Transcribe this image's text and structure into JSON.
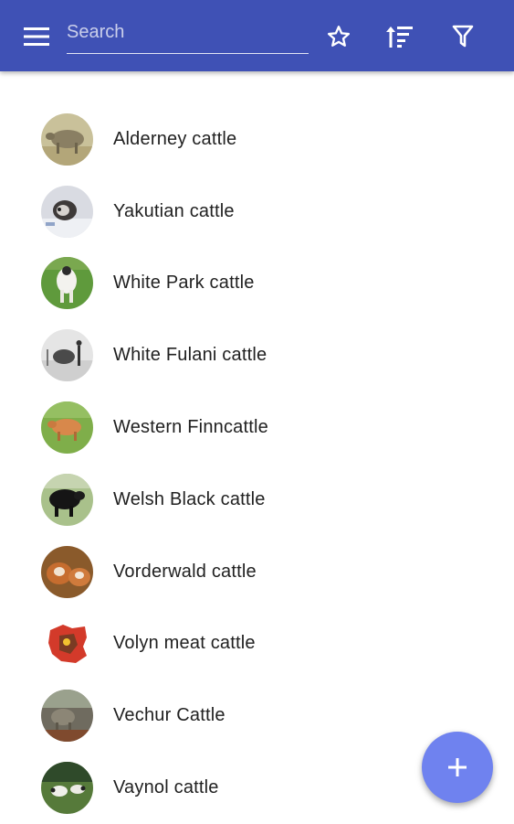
{
  "colors": {
    "appbar": "#3f51b5",
    "fab": "#6f82ef",
    "text": "#212121"
  },
  "appbar": {
    "menu_icon": "hamburger-menu-icon",
    "search": {
      "placeholder": "Search",
      "value": ""
    },
    "favorite_icon": "star-outline-icon",
    "sort_icon": "sort-icon",
    "filter_icon": "filter-icon"
  },
  "list": {
    "items": [
      {
        "label": "Alderney cattle"
      },
      {
        "label": "Yakutian cattle"
      },
      {
        "label": "White Park cattle"
      },
      {
        "label": "White Fulani cattle"
      },
      {
        "label": "Western Finncattle"
      },
      {
        "label": "Welsh Black cattle"
      },
      {
        "label": "Vorderwald cattle"
      },
      {
        "label": "Volyn meat cattle"
      },
      {
        "label": "Vechur Cattle"
      },
      {
        "label": "Vaynol cattle"
      }
    ]
  },
  "fab": {
    "icon": "plus-icon"
  }
}
